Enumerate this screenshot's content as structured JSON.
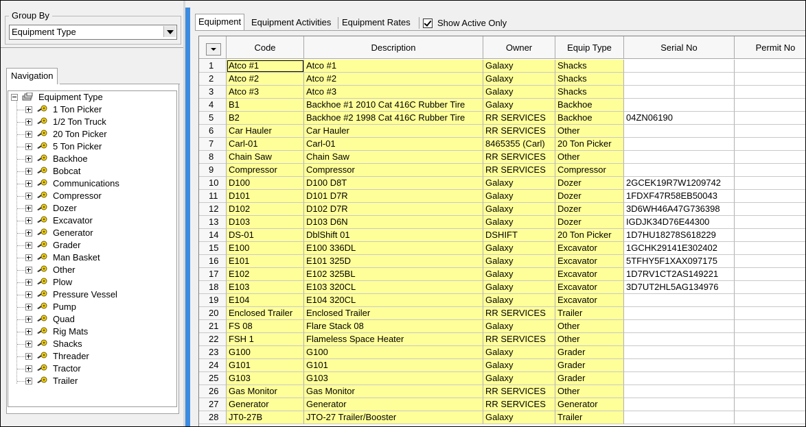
{
  "group_by": {
    "label": "Group By",
    "value": "Equipment Type"
  },
  "navigation": {
    "tab_label": "Navigation",
    "root_label": "Equipment Type",
    "items": [
      "1 Ton Picker",
      "1/2 Ton Truck",
      "20 Ton Picker",
      "5 Ton Picker",
      "Backhoe",
      "Bobcat",
      "Communications",
      "Compressor",
      "Dozer",
      "Excavator",
      "Generator",
      "Grader",
      "Man Basket",
      "Other",
      "Plow",
      "Pressure Vessel",
      "Pump",
      "Quad",
      "Rig Mats",
      "Shacks",
      "Threader",
      "Tractor",
      "Trailer"
    ]
  },
  "tabs": [
    "Equipment",
    "Equipment Activities",
    "Equipment Rates"
  ],
  "show_active_only": {
    "label": "Show Active Only",
    "checked": true
  },
  "grid": {
    "columns": [
      "Code",
      "Description",
      "Owner",
      "Equip Type",
      "Serial No",
      "Permit No"
    ],
    "rows": [
      [
        "1",
        "Atco #1",
        "Atco #1",
        "Galaxy",
        "Shacks",
        ""
      ],
      [
        "2",
        "Atco #2",
        "Atco #2",
        "Galaxy",
        "Shacks",
        ""
      ],
      [
        "3",
        "Atco #3",
        "Atco #3",
        "Galaxy",
        "Shacks",
        ""
      ],
      [
        "4",
        "B1",
        "Backhoe #1 2010 Cat 416C Rubber Tire",
        "Galaxy",
        "Backhoe",
        ""
      ],
      [
        "5",
        "B2",
        "Backhoe #2 1998 Cat 416C Rubber Tire",
        "RR SERVICES",
        "Backhoe",
        "04ZN06190"
      ],
      [
        "6",
        "Car Hauler",
        "Car Hauler",
        "RR SERVICES",
        "Other",
        ""
      ],
      [
        "7",
        "Carl-01",
        "Carl-01",
        "8465355 (Carl)",
        "20 Ton Picker",
        ""
      ],
      [
        "8",
        "Chain Saw",
        "Chain Saw",
        "RR SERVICES",
        "Other",
        ""
      ],
      [
        "9",
        "Compressor",
        "Compressor",
        "RR SERVICES",
        "Compressor",
        ""
      ],
      [
        "10",
        "D100",
        "D100 D8T",
        "Galaxy",
        "Dozer",
        "2GCEK19R7W1209742"
      ],
      [
        "11",
        "D101",
        "D101 D7R",
        "Galaxy",
        "Dozer",
        "1FDXF47R58EB50043"
      ],
      [
        "12",
        "D102",
        "D102 D7R",
        "Galaxy",
        "Dozer",
        "3D6WH46A47G736398"
      ],
      [
        "13",
        "D103",
        "D103 D6N",
        "Galaxy",
        "Dozer",
        "IGDJK34D76E44300"
      ],
      [
        "14",
        "DS-01",
        "DblShift 01",
        "DSHIFT",
        "20 Ton Picker",
        "1D7HU18278S618229"
      ],
      [
        "15",
        "E100",
        "E100 336DL",
        "Galaxy",
        "Excavator",
        "1GCHK29141E302402"
      ],
      [
        "16",
        "E101",
        "E101 325D",
        "Galaxy",
        "Excavator",
        "5TFHY5F1XAX097175"
      ],
      [
        "17",
        "E102",
        "E102 325BL",
        "Galaxy",
        "Excavator",
        "1D7RV1CT2AS149221"
      ],
      [
        "18",
        "E103",
        "E103 320CL",
        "Galaxy",
        "Excavator",
        "3D7UT2HL5AG134976"
      ],
      [
        "19",
        "E104",
        "E104 320CL",
        "Galaxy",
        "Excavator",
        ""
      ],
      [
        "20",
        "Enclosed Trailer",
        "Enclosed Trailer",
        "RR SERVICES",
        "Trailer",
        ""
      ],
      [
        "21",
        "FS 08",
        "Flare Stack 08",
        "Galaxy",
        "Other",
        ""
      ],
      [
        "22",
        "FSH 1",
        "Flameless Space Heater",
        "RR SERVICES",
        "Other",
        ""
      ],
      [
        "23",
        "G100",
        "G100",
        "Galaxy",
        "Grader",
        ""
      ],
      [
        "24",
        "G101",
        "G101",
        "Galaxy",
        "Grader",
        ""
      ],
      [
        "25",
        "G103",
        "G103",
        "Galaxy",
        "Grader",
        ""
      ],
      [
        "26",
        "Gas Monitor",
        "Gas Monitor",
        "RR SERVICES",
        "Other",
        ""
      ],
      [
        "27",
        "Generator",
        "Generator",
        "RR SERVICES",
        "Generator",
        ""
      ],
      [
        "28",
        "JT0-27B",
        "JTO-27 Trailer/Booster",
        "Galaxy",
        "Trailer",
        ""
      ]
    ]
  }
}
